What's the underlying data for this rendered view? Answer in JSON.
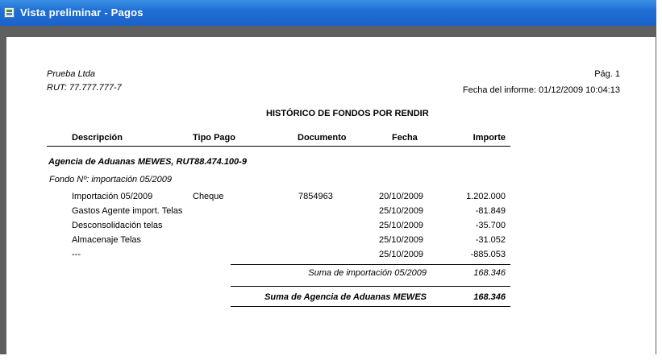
{
  "window": {
    "title": "Vista preliminar - Pagos"
  },
  "report": {
    "company": "Prueba Ltda",
    "rut": "RUT: 77.777.777-7",
    "page": "Pág. 1",
    "report_date": "Fecha del informe: 01/12/2009 10:04:13",
    "title": "HISTÓRICO DE FONDOS POR RENDIR",
    "columns": {
      "descripcion": "Descripción",
      "tipo_pago": "Tipo Pago",
      "documento": "Documento",
      "fecha": "Fecha",
      "importe": "Importe"
    },
    "group_title": "Agencia de Aduanas MEWES,  RUT88.474.100-9",
    "subgroup_title": "Fondo Nº: importación 05/2009",
    "rows": [
      {
        "descripcion": "Importación 05/2009",
        "tipo_pago": "Cheque",
        "documento": "7854963",
        "fecha": "20/10/2009",
        "importe": "1.202.000"
      },
      {
        "descripcion": "Gastos Agente import. Telas",
        "tipo_pago": "",
        "documento": "",
        "fecha": "25/10/2009",
        "importe": "-81.849"
      },
      {
        "descripcion": "Desconsolidación telas",
        "tipo_pago": "",
        "documento": "",
        "fecha": "25/10/2009",
        "importe": "-35.700"
      },
      {
        "descripcion": "Almacenaje Telas",
        "tipo_pago": "",
        "documento": "",
        "fecha": "25/10/2009",
        "importe": "-31.052"
      },
      {
        "descripcion": "---",
        "tipo_pago": "",
        "documento": "",
        "fecha": "25/10/2009",
        "importe": "-885.053"
      }
    ],
    "subtotal": {
      "label": "Suma de importación 05/2009",
      "value": "168.346"
    },
    "total": {
      "label": "Suma de Agencia de Aduanas MEWES",
      "value": "168.346"
    }
  }
}
